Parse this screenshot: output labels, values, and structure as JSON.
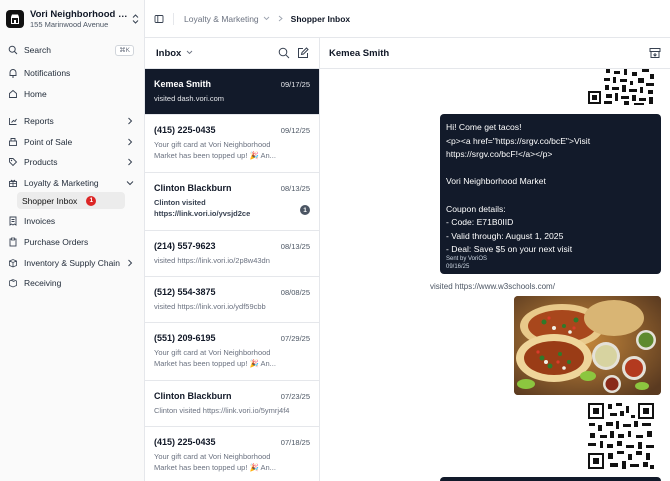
{
  "org": {
    "name": "Vori Neighborhood Market",
    "address": "155 Marinwood Avenue"
  },
  "sidebar": {
    "search_label": "Search",
    "search_shortcut": "⌘K",
    "items": [
      {
        "label": "Notifications"
      },
      {
        "label": "Home"
      },
      {
        "label": "Reports"
      },
      {
        "label": "Point of Sale"
      },
      {
        "label": "Products"
      },
      {
        "label": "Loyalty & Marketing"
      },
      {
        "label": "Invoices"
      },
      {
        "label": "Purchase Orders"
      },
      {
        "label": "Inventory & Supply Chain"
      },
      {
        "label": "Receiving"
      }
    ],
    "sub_item": {
      "label": "Shopper Inbox",
      "badge": "1"
    }
  },
  "breadcrumb": {
    "parent": "Loyalty & Marketing",
    "current": "Shopper Inbox"
  },
  "inbox": {
    "title": "Inbox",
    "conversations": [
      {
        "name": "Kemea Smith",
        "date": "09/17/25",
        "preview": [
          "visited dash.vori.com"
        ]
      },
      {
        "name": "(415) 225-0435",
        "date": "09/12/25",
        "preview": [
          "Your gift card at Vori Neighborhood",
          "Market has been topped up! 🎉 An..."
        ]
      },
      {
        "name": "Clinton Blackburn",
        "date": "08/13/25",
        "preview": [
          "Clinton visited",
          "https://link.vori.io/yvsjd2ce"
        ],
        "badge": "1"
      },
      {
        "name": "(214) 557-9623",
        "date": "08/13/25",
        "preview": [
          "visited https://link.vori.io/2p8w43dn"
        ]
      },
      {
        "name": "(512) 554-3875",
        "date": "08/08/25",
        "preview": [
          "visited https://link.vori.io/ydf59cbb"
        ]
      },
      {
        "name": "(551) 209-6195",
        "date": "07/29/25",
        "preview": [
          "Your gift card at Vori Neighborhood",
          "Market has been topped up! 🎉 An..."
        ]
      },
      {
        "name": "Clinton Blackburn",
        "date": "07/23/25",
        "preview": [
          "Clinton visited https://link.vori.io/5ymrj4f4"
        ]
      },
      {
        "name": "(415) 225-0435",
        "date": "07/18/25",
        "preview": [
          "Your gift card at Vori Neighborhood",
          "Market has been topped up! 🎉 An..."
        ]
      }
    ]
  },
  "chat": {
    "title": "Kemea Smith",
    "outgoing": {
      "lines": [
        "Hi! Come get tacos!",
        "<p><a href=\"https://srgv.co/bcE\">Visit",
        "https://srgv.co/bcF!</a></p>",
        "",
        "Vori Neighborhood Market",
        "",
        "Coupon details:",
        "- Code: E71B0IID",
        "- Valid through: August 1, 2025",
        "- Deal: Save $5 on your next visit"
      ],
      "sent_by": "Sent by VoriOS",
      "date": "09/16/25"
    },
    "incoming_text": "visited https://www.w3schools.com/"
  }
}
